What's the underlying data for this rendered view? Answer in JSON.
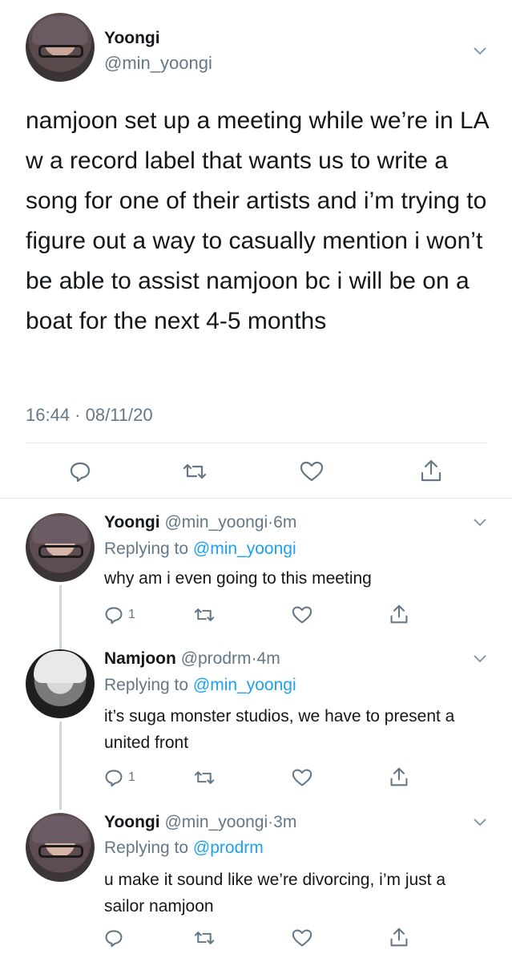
{
  "main_tweet": {
    "name": "Yoongi",
    "handle": "@min_yoongi",
    "text": "namjoon set up a meeting while we’re in LA w a record label that wants us to write a song for one of their artists and i’m trying to figure out a way to casually mention i won’t be able to assist namjoon bc i will be on a boat for the next 4-5 months",
    "timestamp": "16:44 · 08/11/20"
  },
  "replies": [
    {
      "name": "Yoongi",
      "handle": "@min_yoongi",
      "time": "6m",
      "replying_prefix": "Replying to",
      "replying_to": "@min_yoongi",
      "text": "why am i even going to this meeting",
      "reply_count": "1"
    },
    {
      "name": "Namjoon",
      "handle": "@prodrm",
      "time": "4m",
      "replying_prefix": "Replying to",
      "replying_to": "@min_yoongi",
      "text": "it’s suga monster studios, we have to present a united front",
      "reply_count": "1"
    },
    {
      "name": "Yoongi",
      "handle": "@min_yoongi",
      "time": "3m",
      "replying_prefix": "Replying to",
      "replying_to": "@prodrm",
      "text": "u make it sound like we’re divorcing, i’m just a sailor namjoon",
      "reply_count": ""
    }
  ],
  "colors": {
    "text": "#14171a",
    "secondary": "#657786",
    "link": "#1da1f2",
    "divider": "#e1e8ed"
  }
}
